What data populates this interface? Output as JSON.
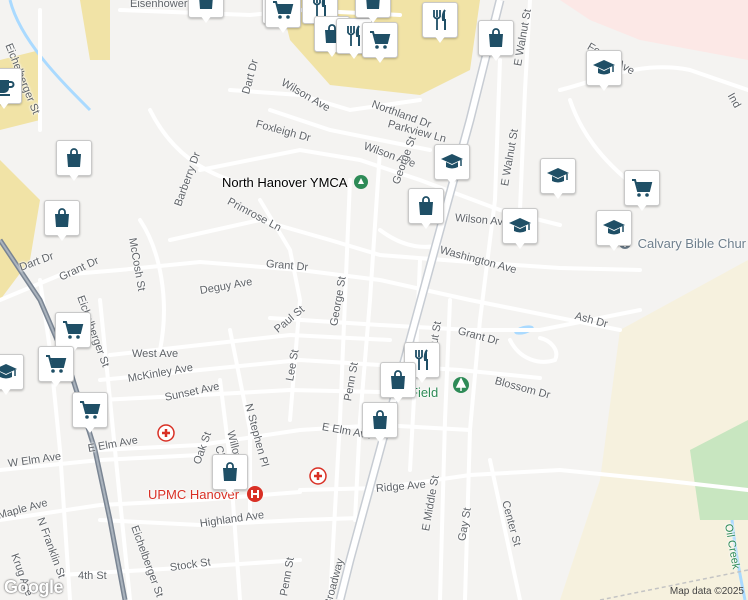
{
  "colors": {
    "background": "#f4f3f1",
    "road": "#ffffff",
    "road_casing": "#e1e1e1",
    "highway": "#c7ccd3",
    "rail": "#6b7785",
    "water": "#aadaff",
    "park": "#c8e6c0",
    "built_area": "#f1e3a6",
    "marker_icon": "#1f4f66",
    "label": "#5f6368",
    "poi_green": "#2e8b57",
    "poi_red": "#d93025",
    "church": "#6e7f8d"
  },
  "street_labels": [
    {
      "text": "Eisenhower"
    },
    {
      "text": "Eichelberger St"
    },
    {
      "text": "Wilson Ave"
    },
    {
      "text": "Dart Dr"
    },
    {
      "text": "Foxleigh Dr"
    },
    {
      "text": "Northland Dr"
    },
    {
      "text": "Parkview Ln"
    },
    {
      "text": "Wilson Ave"
    },
    {
      "text": "George St"
    },
    {
      "text": "E Walnut St"
    },
    {
      "text": "E Walnut St"
    },
    {
      "text": "Barberry Dr"
    },
    {
      "text": "Primrose Ln"
    },
    {
      "text": "Dart Dr"
    },
    {
      "text": "Grant Dr"
    },
    {
      "text": "McCosh St"
    },
    {
      "text": "Eichelberger St"
    },
    {
      "text": "Deguy Ave"
    },
    {
      "text": "Grant Dr"
    },
    {
      "text": "George St"
    },
    {
      "text": "Wilson Ave"
    },
    {
      "text": "Washington Ave"
    },
    {
      "text": "Paul St"
    },
    {
      "text": "Grant Dr"
    },
    {
      "text": "Ash Dr"
    },
    {
      "text": "West Ave"
    },
    {
      "text": "Lee St"
    },
    {
      "text": "Penn St"
    },
    {
      "text": "Walnut St"
    },
    {
      "text": "McKinley Ave"
    },
    {
      "text": "N Stephen Pl"
    },
    {
      "text": "Blossom Dr"
    },
    {
      "text": "Sunset Ave"
    },
    {
      "text": "Willow St"
    },
    {
      "text": "E Elm Ave"
    },
    {
      "text": "Chas"
    },
    {
      "text": "E Elm Ave"
    },
    {
      "text": "W Elm Ave"
    },
    {
      "text": "Oak St"
    },
    {
      "text": "Ridge Ave"
    },
    {
      "text": "E Middle St"
    },
    {
      "text": "Center St"
    },
    {
      "text": "Gay St"
    },
    {
      "text": "Maple Ave"
    },
    {
      "text": "N Franklin St"
    },
    {
      "text": "Highland Ave"
    },
    {
      "text": "Eichelberger St"
    },
    {
      "text": "Krug Ave"
    },
    {
      "text": "4th St"
    },
    {
      "text": "Stock St"
    },
    {
      "text": "Penn St"
    },
    {
      "text": "Broadway"
    },
    {
      "text": "Forest Ave"
    },
    {
      "text": "Oil Creek"
    },
    {
      "text": "Ind"
    },
    {
      "text": "Field"
    }
  ],
  "poi_labels": [
    {
      "text": "North Hanover YMCA",
      "color": "#2e8b57",
      "icon": "ymca-icon"
    },
    {
      "text": "Calvary Bible Chur",
      "color": "#6e7f8d",
      "icon": "church-icon"
    },
    {
      "text": "UPMC Hanover",
      "color": "#d93025",
      "icon": "hospital-icon"
    }
  ],
  "markers": [
    {
      "icon": "shopping-bag-icon"
    },
    {
      "icon": "shopping-cart-icon"
    },
    {
      "icon": "shopping-cart-icon"
    },
    {
      "icon": "restaurant-icon"
    },
    {
      "icon": "shopping-bag-icon"
    },
    {
      "icon": "restaurant-icon"
    },
    {
      "icon": "shopping-cart-icon"
    },
    {
      "icon": "shopping-bag-icon"
    },
    {
      "icon": "restaurant-icon"
    },
    {
      "icon": "shopping-bag-icon"
    },
    {
      "icon": "school-icon"
    },
    {
      "icon": "coffee-icon"
    },
    {
      "icon": "shopping-bag-icon"
    },
    {
      "icon": "school-icon"
    },
    {
      "icon": "school-icon"
    },
    {
      "icon": "shopping-cart-icon"
    },
    {
      "icon": "shopping-bag-icon"
    },
    {
      "icon": "shopping-bag-icon"
    },
    {
      "icon": "school-icon"
    },
    {
      "icon": "school-icon"
    },
    {
      "icon": "shopping-cart-icon"
    },
    {
      "icon": "shopping-cart-icon"
    },
    {
      "icon": "school-icon"
    },
    {
      "icon": "restaurant-icon"
    },
    {
      "icon": "shopping-bag-icon"
    },
    {
      "icon": "shopping-cart-icon"
    },
    {
      "icon": "shopping-bag-icon"
    },
    {
      "icon": "shopping-bag-icon"
    }
  ],
  "attribution": "Map data ©2025",
  "logo": "Google"
}
